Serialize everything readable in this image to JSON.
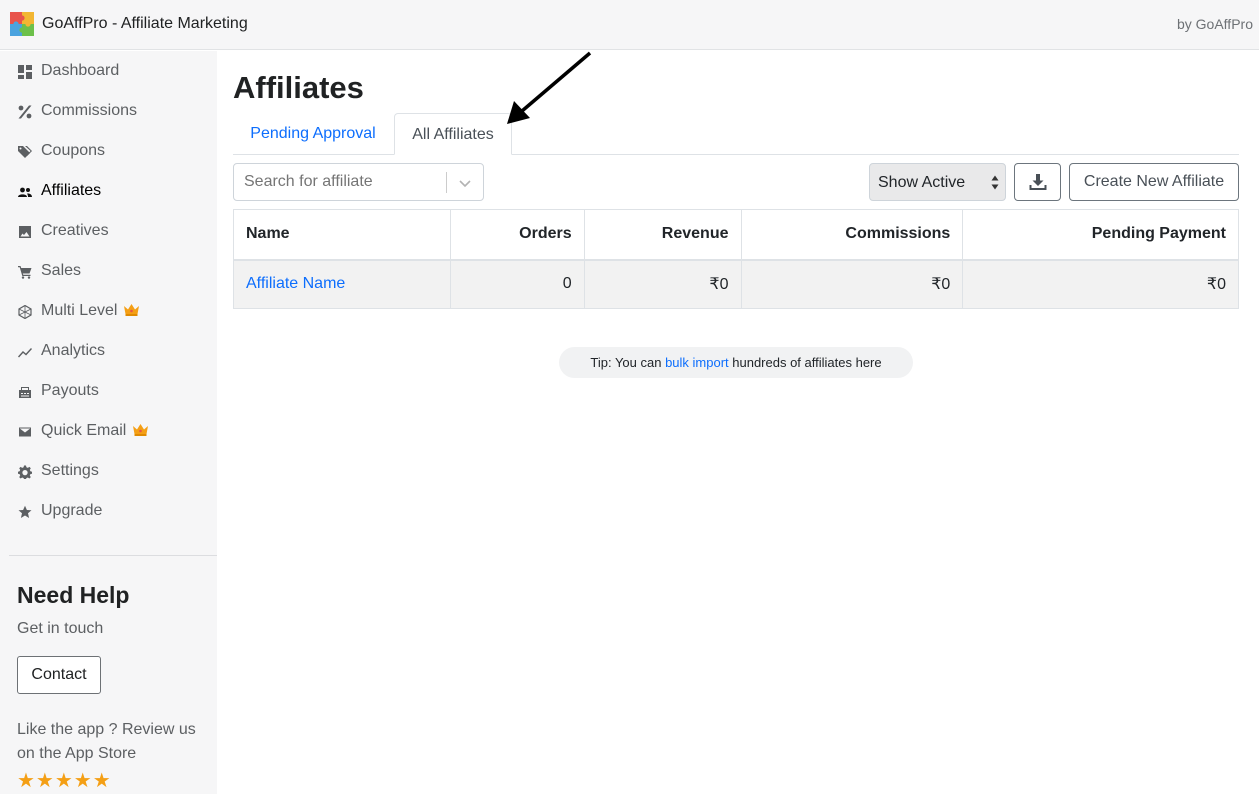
{
  "header": {
    "app_title": "GoAffPro - Affiliate Marketing",
    "by_label": "by GoAffPro",
    "logo_icon": "puzzle-logo-icon"
  },
  "sidebar": {
    "items": [
      {
        "label": "Dashboard",
        "icon": "dashboard-icon"
      },
      {
        "label": "Commissions",
        "icon": "percent-icon"
      },
      {
        "label": "Coupons",
        "icon": "tags-icon"
      },
      {
        "label": "Affiliates",
        "icon": "users-icon",
        "active": true
      },
      {
        "label": "Creatives",
        "icon": "image-icon"
      },
      {
        "label": "Sales",
        "icon": "cart-icon"
      },
      {
        "label": "Multi Level",
        "icon": "network-icon",
        "premium": true
      },
      {
        "label": "Analytics",
        "icon": "trend-icon"
      },
      {
        "label": "Payouts",
        "icon": "cash-register-icon"
      },
      {
        "label": "Quick Email",
        "icon": "envelope-icon",
        "premium": true
      },
      {
        "label": "Settings",
        "icon": "gear-icon"
      },
      {
        "label": "Upgrade",
        "icon": "star-icon"
      }
    ],
    "help": {
      "title": "Need Help",
      "subtitle": "Get in touch",
      "contact_label": "Contact",
      "review_text": "Like the app ? Review us on the App Store",
      "stars": "★★★★★"
    }
  },
  "main": {
    "title": "Affiliates",
    "tabs": [
      {
        "label": "Pending Approval",
        "active": false
      },
      {
        "label": "All Affiliates",
        "active": true
      }
    ],
    "search": {
      "placeholder": "Search for affiliate",
      "value": ""
    },
    "filter_select": {
      "value": "Show Active"
    },
    "download_icon": "download-icon",
    "create_label": "Create New Affiliate",
    "table": {
      "columns": [
        "Name",
        "Orders",
        "Revenue",
        "Commissions",
        "Pending Payment"
      ],
      "rows": [
        {
          "name": "Affiliate Name",
          "orders": "0",
          "revenue": "₹0",
          "commissions": "₹0",
          "pending": "₹0"
        }
      ]
    },
    "tip": {
      "prefix": "Tip: You can ",
      "link": "bulk import",
      "suffix": " hundreds of affiliates here"
    }
  },
  "colors": {
    "accent": "#0d6efd",
    "sidebar_bg": "#f6f6f7",
    "star": "#f49f15",
    "crown": "#f49f15"
  }
}
